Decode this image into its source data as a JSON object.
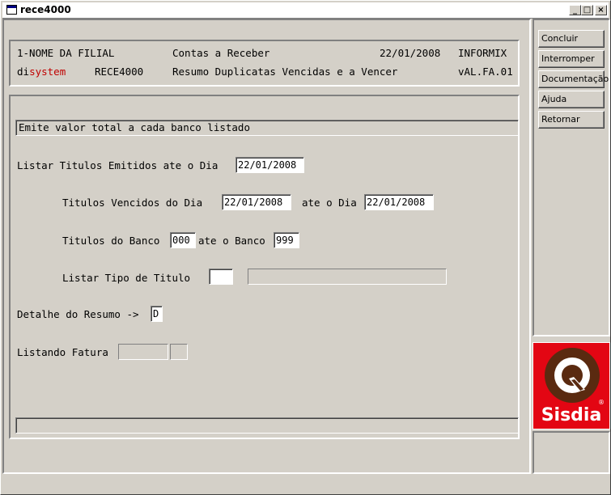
{
  "window": {
    "title": "rece4000",
    "controls": {
      "minimize": "_",
      "maximize": "□",
      "close": "×"
    }
  },
  "header": {
    "line1": {
      "filial": "1-NOME DA FILIAL",
      "modulo": "Contas a Receber",
      "data": "22/01/2008",
      "banco_dados": "INFORMIX"
    },
    "line2": {
      "logo_di": "di",
      "logo_system": "system",
      "programa": "RECE4000",
      "descricao": "Resumo Duplicatas Vencidas e a Vencer",
      "versao": "vAL.FA.01"
    }
  },
  "form": {
    "info_message": "Emite valor total a cada banco listado",
    "listar_titulos_label": "Listar Titulos Emitidos ate o Dia",
    "listar_titulos_value": "22/01/2008",
    "vencidos_label": "Titulos Vencidos do Dia",
    "vencidos_de_value": "22/01/2008",
    "ate_o_dia_label": "ate o Dia",
    "vencidos_ate_value": "22/01/2008",
    "banco_label": "Titulos do Banco",
    "banco_de_value": "000",
    "ate_o_banco_label": "ate o Banco",
    "banco_ate_value": "999",
    "tipo_titulo_label": "Listar Tipo de Titulo",
    "tipo_titulo_value": "",
    "tipo_titulo_desc": "",
    "detalhe_label": "Detalhe do Resumo ->",
    "detalhe_value": "D",
    "listando_fatura_label": "Listando Fatura",
    "listando_fatura_value": "",
    "listando_fatura_flag": "",
    "status_text": ""
  },
  "side_buttons": {
    "concluir": "Concluir",
    "interromper": "Interromper",
    "documentacao": "Documentação",
    "ajuda": "Ajuda",
    "retornar": "Retornar"
  },
  "logo": {
    "brand": "Sisdia",
    "colors": {
      "background": "#e30613",
      "ring": "#5a2a10"
    }
  }
}
